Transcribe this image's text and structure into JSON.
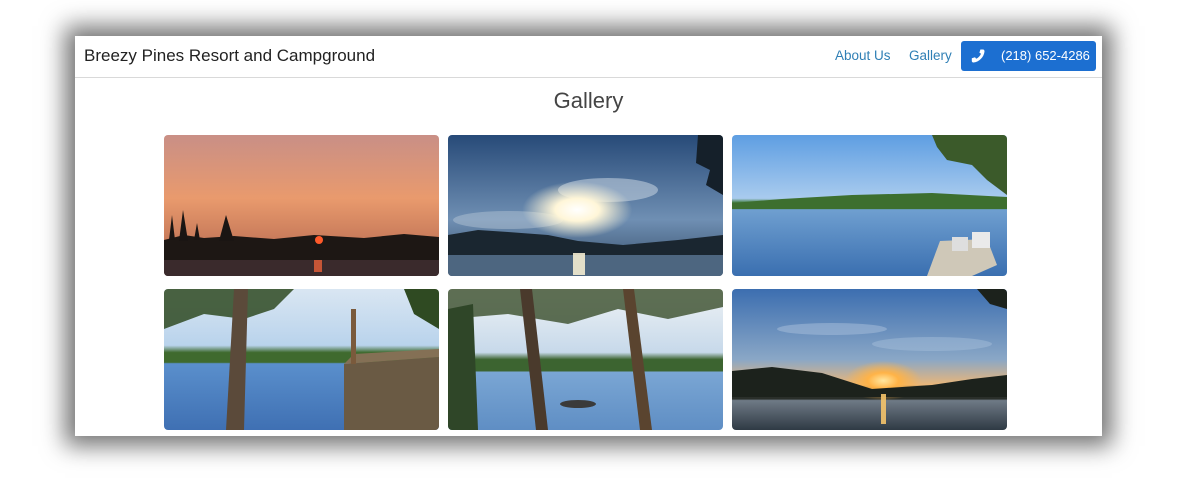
{
  "header": {
    "brand": "Breezy Pines Resort and Campground",
    "nav": [
      "About Us",
      "Gallery"
    ],
    "phone": "(218) 652-4286",
    "phone_icon": "phone-icon"
  },
  "main": {
    "title": "Gallery",
    "photos": [
      {
        "subject": "pink sunset over lake with tree silhouettes"
      },
      {
        "subject": "bright sun over lake with clouds"
      },
      {
        "subject": "blue lake with dock and chairs"
      },
      {
        "subject": "pine tree by lake with boathouse roof"
      },
      {
        "subject": "pine trunks framing lake with boat"
      },
      {
        "subject": "orange sunset over lake"
      }
    ]
  },
  "colors": {
    "accent": "#1c6fd1",
    "link": "#2f7fb5"
  }
}
